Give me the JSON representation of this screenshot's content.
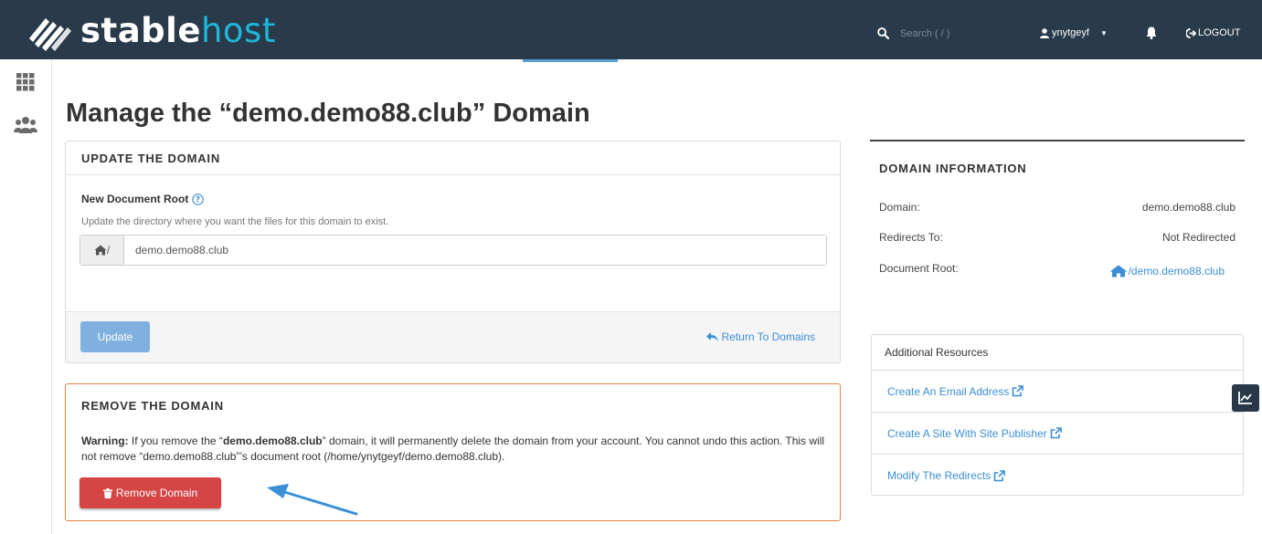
{
  "brand": {
    "name_bold": "stable",
    "name_light": "host"
  },
  "topbar": {
    "search_placeholder": "Search ( / )",
    "username": "ynytgeyf",
    "logout_label": "LOGOUT"
  },
  "page": {
    "title": "Manage the “demo.demo88.club” Domain"
  },
  "update_panel": {
    "heading": "UPDATE THE DOMAIN",
    "field_label": "New Document Root",
    "field_help": "Update the directory where you want the files for this domain to exist.",
    "addon_text": "/",
    "field_value": "demo.demo88.club",
    "update_button": "Update",
    "return_link": "Return To Domains"
  },
  "remove_panel": {
    "heading": "REMOVE THE DOMAIN",
    "warning_label": "Warning:",
    "warning_text_1": " If you remove the “",
    "warning_domain": "demo.demo88.club",
    "warning_text_2": "” domain, it will permanently delete the domain from your account. You cannot undo this action. This will not remove “demo.demo88.club”’s document root (/home/ynytgeyf/demo.demo88.club).",
    "remove_button": "Remove Domain"
  },
  "domain_info": {
    "heading": "DOMAIN INFORMATION",
    "rows": [
      {
        "label": "Domain:",
        "value": "demo.demo88.club"
      },
      {
        "label": "Redirects To:",
        "value": "Not Redirected"
      },
      {
        "label": "Document Root:",
        "value": "/demo.demo88.club"
      }
    ]
  },
  "resources": {
    "heading": "Additional Resources",
    "items": [
      {
        "label": "Create An Email Address"
      },
      {
        "label": "Create A Site With Site Publisher"
      },
      {
        "label": "Modify The Redirects"
      }
    ]
  },
  "colors": {
    "topbar": "#293a4a",
    "brand_accent": "#1fb6d8",
    "link": "#3b8fd5",
    "update_button": "#7fb0de",
    "remove_button": "#d64545",
    "remove_border": "#e8823e",
    "arrow": "#3b8fd5"
  },
  "icons": {
    "search": "search-icon",
    "user": "user-icon",
    "bell": "bell-icon",
    "logout": "logout-icon",
    "apps": "apps-grid-icon",
    "users": "users-icon",
    "help": "question-circle-icon",
    "home": "home-icon",
    "reply": "reply-icon",
    "trash": "trash-icon",
    "external": "external-link-icon",
    "chart": "line-chart-icon"
  }
}
